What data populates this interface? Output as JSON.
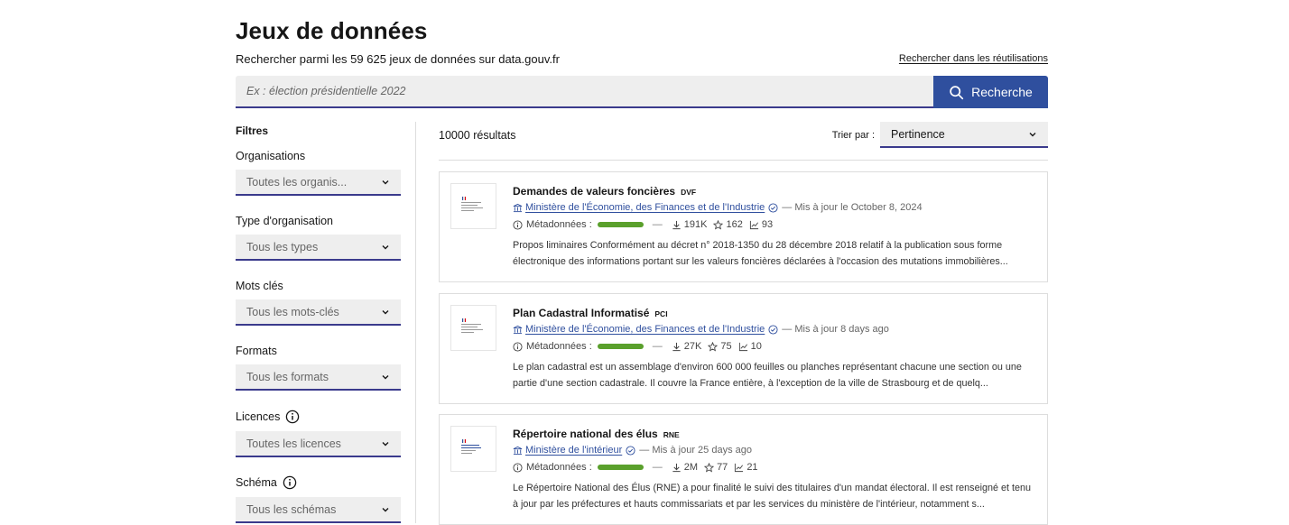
{
  "header": {
    "title": "Jeux de données",
    "subtitle": "Rechercher parmi les 59 625 jeux de données sur data.gouv.fr",
    "reuse_link": "Rechercher dans les réutilisations"
  },
  "search": {
    "placeholder": "Ex : élection présidentielle 2022",
    "button_label": "Recherche"
  },
  "sidebar": {
    "title": "Filtres",
    "filters": [
      {
        "label": "Organisations",
        "value": "Toutes les organis..."
      },
      {
        "label": "Type d'organisation",
        "value": "Tous les types"
      },
      {
        "label": "Mots clés",
        "value": "Tous les mots-clés"
      },
      {
        "label": "Formats",
        "value": "Tous les formats"
      },
      {
        "label": "Licences",
        "value": "Toutes les licences"
      },
      {
        "label": "Schéma",
        "value": "Tous les schémas"
      }
    ]
  },
  "results": {
    "count": "10000 résultats",
    "sort_label": "Trier par :",
    "sort_value": "Pertinence",
    "items": [
      {
        "title": "Demandes de valeurs foncières",
        "acronym": "DVF",
        "organization": "Ministère de l'Économie, des Finances et de l'Industrie",
        "updated": "— Mis à jour le October 8, 2024",
        "metadata_label": "Métadonnées :",
        "downloads": "191K",
        "stars": "162",
        "reuses": "93",
        "description": "Propos liminaires Conformément au décret n° 2018-1350 du 28 décembre 2018 relatif à la publication sous forme électronique des informations portant sur les valeurs foncières déclarées à l'occasion des mutations immobilières..."
      },
      {
        "title": "Plan Cadastral Informatisé",
        "acronym": "PCI",
        "organization": "Ministère de l'Économie, des Finances et de l'Industrie",
        "updated": "— Mis à jour 8 days ago",
        "metadata_label": "Métadonnées :",
        "downloads": "27K",
        "stars": "75",
        "reuses": "10",
        "description": "Le plan cadastral est un assemblage d'environ 600 000 feuilles ou planches représentant chacune une section ou une partie d'une section cadastrale. Il couvre la France entière, à l'exception de la ville de Strasbourg et de quelq..."
      },
      {
        "title": "Répertoire national des élus",
        "acronym": "RNE",
        "organization": "Ministère de l'intérieur",
        "updated": "— Mis à jour 25 days ago",
        "metadata_label": "Métadonnées :",
        "downloads": "2M",
        "stars": "77",
        "reuses": "21",
        "description": "Le Répertoire National des Élus (RNE) a pour finalité le suivi des titulaires d'un mandat électoral. Il est renseigné et tenu à jour par les préfectures et hauts commissariats et par les services du ministère de l'intérieur, notamment s..."
      }
    ]
  },
  "colors": {
    "accent": "#2f4f9e",
    "quality_bar": "#5aa02c",
    "field_bg": "#eeeeee"
  }
}
